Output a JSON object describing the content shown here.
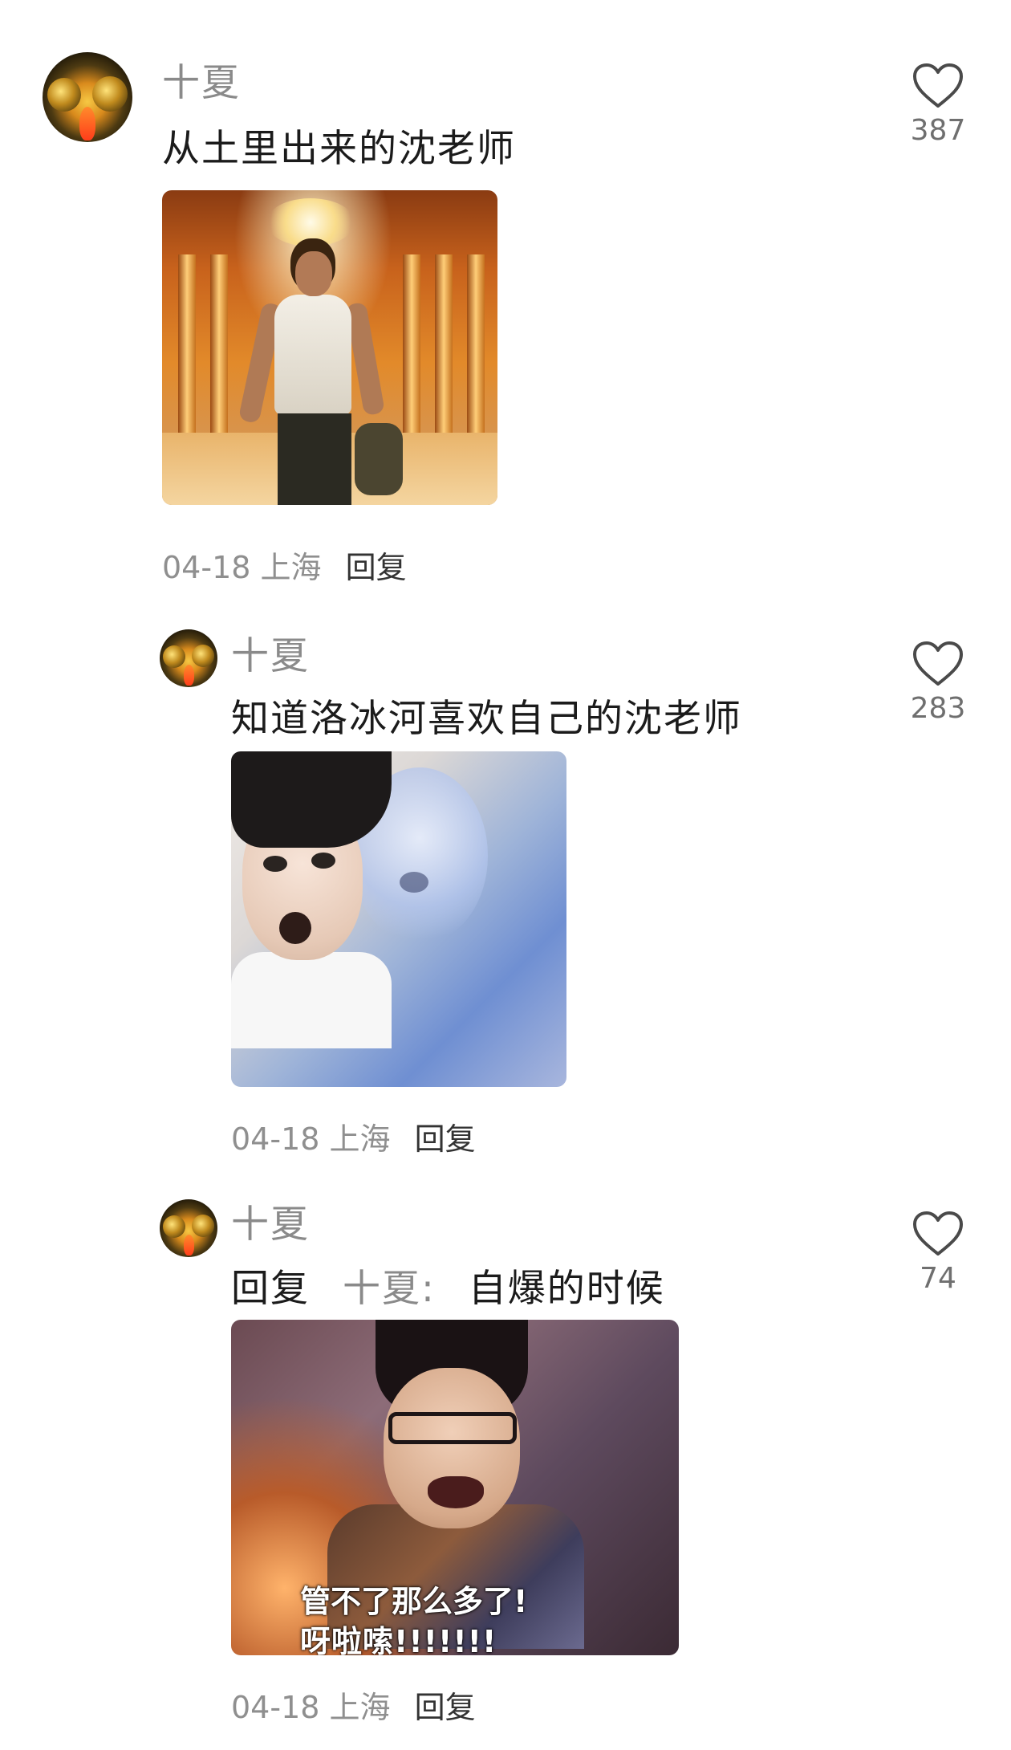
{
  "comments": [
    {
      "username": "十夏",
      "text": "从土里出来的沈老师",
      "likes": "387",
      "date": "04-18",
      "location": "上海",
      "reply_label": "回复"
    },
    {
      "username": "十夏",
      "text": "知道洛冰河喜欢自己的沈老师",
      "likes": "283",
      "date": "04-18",
      "location": "上海",
      "reply_label": "回复"
    },
    {
      "username": "十夏",
      "reply_word": "回复",
      "reply_target": "十夏",
      "separator": ":",
      "text": "自爆的时候",
      "likes": "74",
      "date": "04-18",
      "location": "上海",
      "reply_label": "回复",
      "image_caption_line1": "管不了那么多了!",
      "image_caption_line2": "呀啦嗦!!!!!!!"
    }
  ],
  "icons": {
    "like": "heart-outline-icon"
  },
  "colors": {
    "username": "#8a8a8a",
    "meta": "#8f8f8f",
    "text": "#1b1b1b"
  }
}
